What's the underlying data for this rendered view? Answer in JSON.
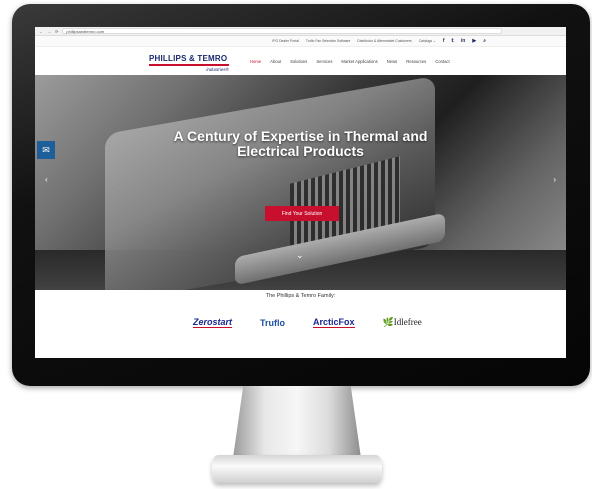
{
  "browser": {
    "url": "phillipsandtemro.com",
    "back_icon": "back-arrow-icon",
    "reload_icon": "reload-icon"
  },
  "utility_bar": {
    "links": [
      "IPG Dealer Portal",
      "Truflo Fan Selection Software",
      "Distributor & Aftermarket Customers",
      "Catalogs"
    ],
    "social": [
      "f",
      "t",
      "in",
      "yt"
    ],
    "search_icon": "search-icon"
  },
  "brand": {
    "name_line1": "PHILLIPS & TEMRO",
    "name_line2": "industries®"
  },
  "nav": {
    "items": [
      "Home",
      "About",
      "Solutions",
      "Services",
      "Market Applications",
      "News",
      "Resources",
      "Contact"
    ]
  },
  "hero": {
    "headline_line1": "A Century of Expertise in Thermal and",
    "headline_line2": "Electrical Products",
    "cta_label": "Find Your Solution",
    "slide_count": 5,
    "active_slide": 1,
    "accent_color": "#c8102e"
  },
  "family": {
    "title": "The Phillips & Temro Family:",
    "brands": [
      "Zerostart",
      "Truflo",
      "ArcticFox",
      "Idlefree"
    ]
  }
}
